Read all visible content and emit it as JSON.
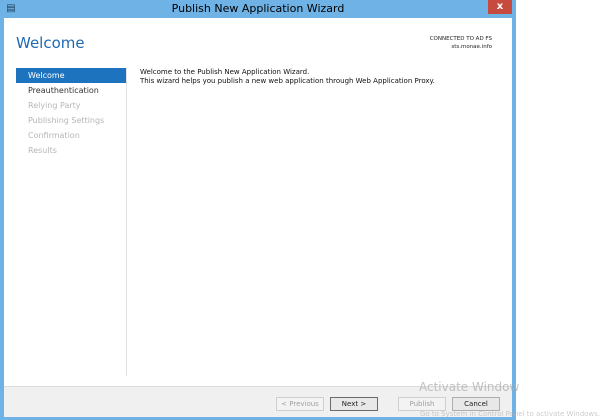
{
  "window": {
    "title": "Publish New Application Wizard",
    "close_glyph": "x",
    "app_icon": "server-manager-icon"
  },
  "header": {
    "page_title": "Welcome",
    "connection_label": "CONNECTED TO AD FS",
    "connection_server": "sts.monae.info"
  },
  "nav": {
    "items": [
      {
        "label": "Welcome",
        "state": "selected"
      },
      {
        "label": "Preauthentication",
        "state": "enabled"
      },
      {
        "label": "Relying Party",
        "state": "disabled"
      },
      {
        "label": "Publishing Settings",
        "state": "disabled"
      },
      {
        "label": "Confirmation",
        "state": "disabled"
      },
      {
        "label": "Results",
        "state": "disabled"
      }
    ]
  },
  "content": {
    "line1": "Welcome to the Publish New Application Wizard.",
    "line2": "This wizard helps you publish a new web application through Web Application Proxy."
  },
  "footer": {
    "prev_label": "< Previous",
    "next_label": "Next >",
    "publish_label": "Publish",
    "cancel_label": "Cancel"
  },
  "watermark": {
    "line1": "Activate Window",
    "line2": "Go to System in Control Panel to activate Windows."
  }
}
